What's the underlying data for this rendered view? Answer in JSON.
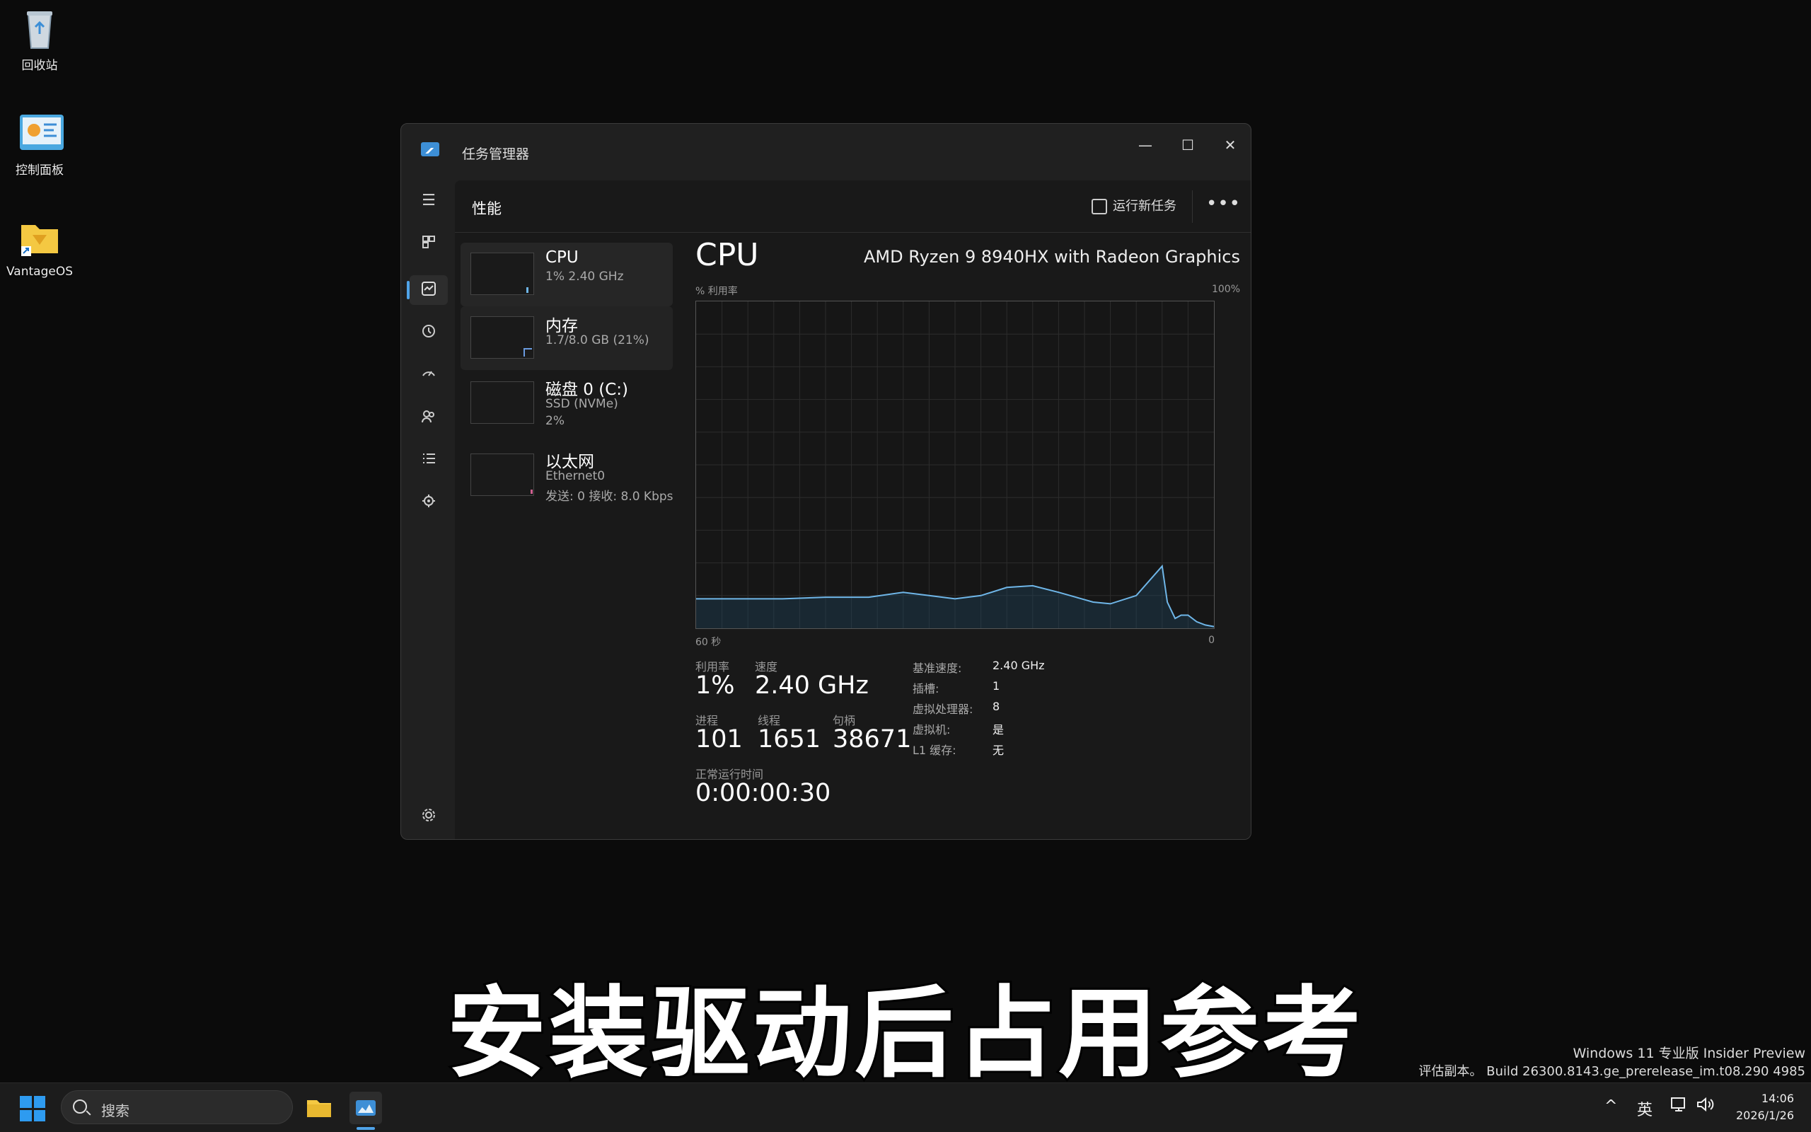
{
  "desktop": {
    "icons": [
      {
        "label": "回收站"
      },
      {
        "label": "控制面板"
      },
      {
        "label": "VantageOS"
      }
    ]
  },
  "window": {
    "title": "任务管理器",
    "controls": {
      "minimize": "—",
      "maximize": "☐",
      "close": "✕"
    }
  },
  "header": {
    "page_title": "性能",
    "run_task_label": "运行新任务",
    "more_label": "•••"
  },
  "resources": [
    {
      "name": "CPU",
      "sub1": "1% 2.40 GHz",
      "sub2": ""
    },
    {
      "name": "内存",
      "sub1": "1.7/8.0 GB (21%)",
      "sub2": ""
    },
    {
      "name": "磁盘 0 (C:)",
      "sub1": "SSD (NVMe)",
      "sub2": "2%"
    },
    {
      "name": "以太网",
      "sub1": "Ethernet0",
      "sub2": "发送: 0 接收: 8.0 Kbps"
    }
  ],
  "detail": {
    "title": "CPU",
    "model": "AMD Ryzen 9 8940HX with Radeon Graphics",
    "graph_top_left": "% 利用率",
    "graph_top_right": "100%",
    "graph_bottom_left": "60 秒",
    "graph_bottom_right": "0",
    "stats": {
      "utilization_label": "利用率",
      "utilization_value": "1%",
      "speed_label": "速度",
      "speed_value": "2.40 GHz",
      "processes_label": "进程",
      "processes_value": "101",
      "threads_label": "线程",
      "threads_value": "1651",
      "handles_label": "句柄",
      "handles_value": "38671",
      "uptime_label": "正常运行时间",
      "uptime_value": "0:00:00:30"
    },
    "specs": [
      {
        "key": "基准速度:",
        "value": "2.40 GHz"
      },
      {
        "key": "插槽:",
        "value": "1"
      },
      {
        "key": "虚拟处理器:",
        "value": "8"
      },
      {
        "key": "虚拟机:",
        "value": "是"
      },
      {
        "key": "L1 缓存:",
        "value": "无"
      }
    ]
  },
  "chart_data": {
    "type": "line",
    "xlabel": "60 秒",
    "ylabel": "% 利用率",
    "xlim": [
      60,
      0
    ],
    "ylim": [
      0,
      100
    ],
    "grid": true,
    "series": [
      {
        "x": [
          60,
          55,
          50,
          45,
          40,
          36,
          33,
          30,
          27,
          24,
          21,
          18,
          16,
          14,
          12,
          9,
          6,
          5.4,
          4.5,
          3.8,
          3,
          2,
          1,
          0
        ],
        "values": [
          9,
          9,
          9,
          9.5,
          9.5,
          11,
          10,
          9,
          10,
          12.5,
          13,
          11,
          9.5,
          8,
          7.5,
          10,
          19,
          8,
          3,
          4,
          4,
          2,
          1,
          0.5
        ]
      }
    ],
    "colors": {
      "line": "#6fb6e8",
      "fill": "#1f4a66"
    }
  },
  "caption": "安装驱动后占用参考",
  "watermark": {
    "line1": "Windows 11 专业版 Insider Preview",
    "line2": "评估副本。 Build 26300.8143.ge_prerelease_im.t08.290 4985"
  },
  "taskbar": {
    "search_placeholder": "搜索",
    "tray": {
      "chevron": "^",
      "lang": "英"
    },
    "clock_time": "14:06",
    "clock_date": "2026/1/26"
  }
}
